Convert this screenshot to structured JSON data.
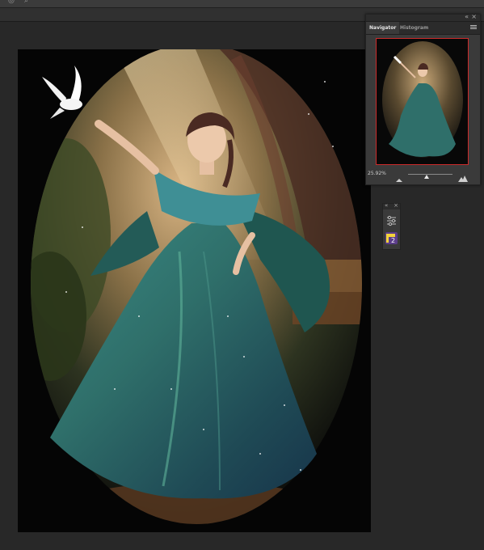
{
  "navigator": {
    "tab_navigator": "Navigator",
    "tab_histogram": "Histogram",
    "zoom_value": "25.92%",
    "zoom_level_fraction": 0.42
  },
  "colors": {
    "background": "#282828",
    "panel": "#3a3a3a",
    "view_box_outline": "#cc2b2b",
    "gown_teal": "#2f6f6a",
    "warm_light": "#d8b483"
  },
  "icons": {
    "top_left_1": "circle-icon",
    "top_left_2": "search-icon",
    "collapse": "double-chevron-icon",
    "close": "close-icon",
    "panel_menu": "menu-icon",
    "adjustments": "sliders-icon",
    "layer_badge": "layers-badge-icon"
  }
}
